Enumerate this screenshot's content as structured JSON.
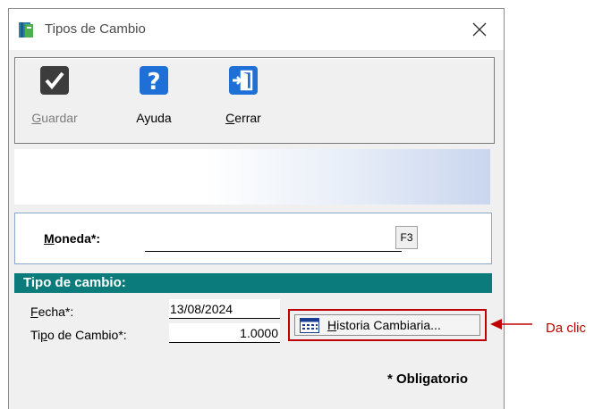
{
  "window": {
    "title": "Tipos de Cambio"
  },
  "toolbar": {
    "guardar": {
      "label_first": "G",
      "label_rest": "uardar",
      "enabled": false
    },
    "ayuda": {
      "label": "Ayuda"
    },
    "cerrar": {
      "label_first": "C",
      "label_rest": "errar"
    }
  },
  "moneda": {
    "label_first": "M",
    "label_rest": "oneda*:",
    "value": "",
    "lookup_key": "F3"
  },
  "tipo_cambio_section": {
    "header": "Tipo de cambio:",
    "fecha": {
      "label_first": "F",
      "label_rest": "echa*:",
      "value": "13/08/2024"
    },
    "tipo": {
      "label_pre": "Ti",
      "label_u": "p",
      "label_rest": "o de Cambio*:",
      "value": "1.0000"
    },
    "historia_button": {
      "label_first": "H",
      "label_rest": "istoria Cambiaria..."
    }
  },
  "footer": {
    "required_note": "* Obligatorio"
  },
  "annotation": {
    "callout_text": "Da clic",
    "color": "#c00000"
  },
  "colors": {
    "section_header": "#0c7b7b",
    "icon_blue": "#1e6fd6",
    "icon_dark": "#3c3c3c"
  }
}
